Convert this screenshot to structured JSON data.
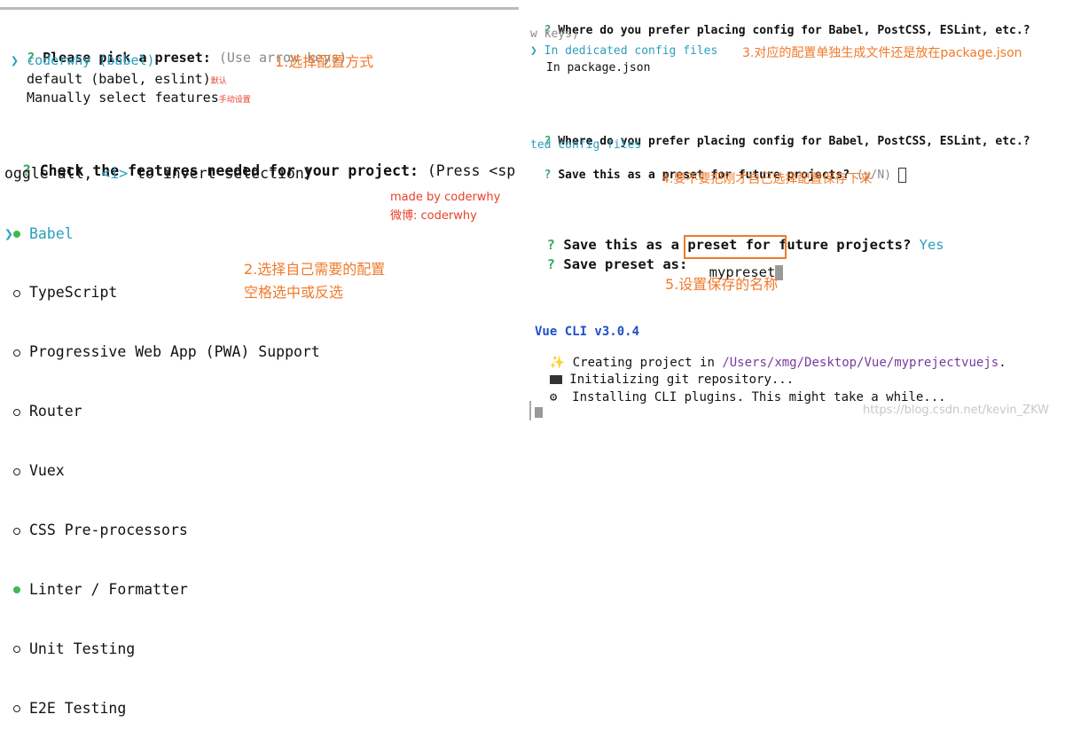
{
  "left": {
    "preset_question": "Please pick a preset:",
    "preset_hint": "(Use arrow keys)",
    "presets": [
      {
        "label": "coderwhy (babel)",
        "note": ""
      },
      {
        "label": "default (babel, eslint)",
        "note": "默认"
      },
      {
        "label": "Manually select features",
        "note": "手动设置"
      }
    ],
    "preset_annotation": "1.选择配置方式",
    "features_question_bold": "Check the features needed for your project:",
    "features_question_rest": "(Press <sp",
    "features_line2_a": "oggle all, ",
    "features_line2_key": "<i>",
    "features_line2_b": " to invert selection)",
    "features": [
      {
        "label": "Babel",
        "checked": true
      },
      {
        "label": "TypeScript",
        "checked": false
      },
      {
        "label": "Progressive Web App (PWA) Support",
        "checked": false
      },
      {
        "label": "Router",
        "checked": false
      },
      {
        "label": "Vuex",
        "checked": false
      },
      {
        "label": "CSS Pre-processors",
        "checked": false
      },
      {
        "label": "Linter / Formatter",
        "checked": true
      },
      {
        "label": "Unit Testing",
        "checked": false
      },
      {
        "label": "E2E Testing",
        "checked": false
      }
    ],
    "made_by": "made by coderwhy",
    "weibo": "微博: coderwhy",
    "features_annotation_1": "2.选择自己需要的配置",
    "features_annotation_2": "空格选中或反选"
  },
  "right": {
    "config_question": "Where do you prefer placing config for Babel, PostCSS, ESLint, etc.?",
    "config_hint": "w keys)",
    "config_opt1": "In dedicated config files",
    "config_opt1_annotation": "3.对应的配置单独生成文件还是放在package.json",
    "config_opt2": "In package.json",
    "config_question2": "Where do you prefer placing config for Babel, PostCSS, ESLint, etc.?",
    "config_answer": "ted config files",
    "save_question": "Save this as a preset for future projects?",
    "save_hint": "(y/N)",
    "save_annotation": "4.要不要把刚才自己选择配置保存下来",
    "save_question2": "Save this as a preset for future projects?",
    "save_answer": "Yes",
    "preset_name_label": "Save preset as:",
    "preset_name_value": "mypreset",
    "preset_name_annotation": "5.设置保存的名称",
    "cli_version": "Vue CLI v3.0.4",
    "creating_text": "Creating project in",
    "creating_path": "/Users/xmg/Desktop/Vue/myprejectvuejs",
    "creating_end": ".",
    "init_git": "Initializing git repository...",
    "install_plugins": "Installing CLI plugins. This might take a while...",
    "watermark": "https://blog.csdn.net/kevin_ZKW"
  },
  "colors": {
    "prompt_green": "#3aa86b",
    "cyan": "#2a9fbd",
    "annotation_orange": "#f07a2a",
    "vue_blue": "#1f50c8",
    "box_orange": "#f07a2a"
  }
}
